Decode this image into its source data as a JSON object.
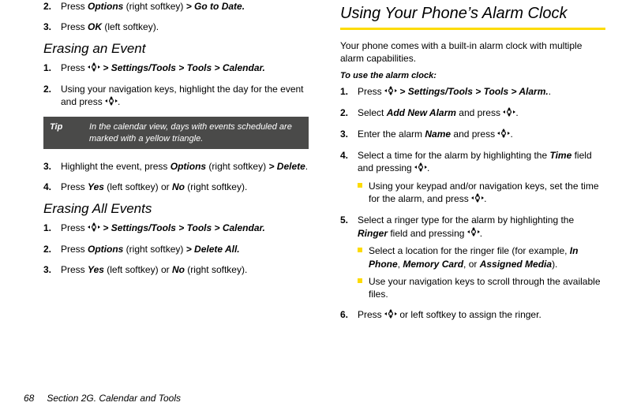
{
  "footer": {
    "page": "68",
    "section": "Section 2G. Calendar and Tools"
  },
  "left": {
    "pre_steps": [
      {
        "n": "2.",
        "parts": [
          "Press ",
          {
            "bi": "Options"
          },
          " (right softkey) ",
          {
            "bi": "> Go to Date."
          }
        ]
      },
      {
        "n": "3.",
        "parts": [
          "Press ",
          {
            "bi": "OK"
          },
          " (left softkey)."
        ]
      }
    ],
    "h2a": "Erasing an Event",
    "steps_a": [
      {
        "n": "1.",
        "parts": [
          "Press ",
          {
            "icon": true
          },
          "  ",
          {
            "bi": "> Settings/Tools > Tools > Calendar."
          }
        ]
      },
      {
        "n": "2.",
        "parts": [
          "Using your navigation keys, highlight the day for the event and press ",
          {
            "icon": true
          },
          "."
        ]
      }
    ],
    "tip": {
      "label": "Tip",
      "text": "In the calendar view, days with events scheduled are marked with a yellow triangle."
    },
    "steps_a2": [
      {
        "n": "3.",
        "parts": [
          "Highlight the event, press ",
          {
            "bi": "Options"
          },
          " (right softkey) ",
          {
            "bi": "> Delete"
          },
          "."
        ]
      },
      {
        "n": "4.",
        "parts": [
          "Press ",
          {
            "bi": "Yes"
          },
          " (left softkey) or ",
          {
            "bi": "No"
          },
          " (right softkey)."
        ]
      }
    ],
    "h2b": "Erasing All Events",
    "steps_b": [
      {
        "n": "1.",
        "parts": [
          "Press ",
          {
            "icon": true
          },
          " ",
          {
            "bi": "> Settings/Tools > Tools > Calendar."
          }
        ]
      },
      {
        "n": "2.",
        "parts": [
          "Press ",
          {
            "bi": "Options"
          },
          " (right softkey) ",
          {
            "bi": "> Delete All."
          }
        ]
      },
      {
        "n": "3.",
        "parts": [
          "Press ",
          {
            "bi": "Yes"
          },
          " (left softkey) or ",
          {
            "bi": "No"
          },
          " (right softkey)."
        ]
      }
    ]
  },
  "right": {
    "h1": "Using Your Phone’s Alarm Clock",
    "intro": "Your phone comes with a built-in alarm clock with multiple alarm capabilities.",
    "runin": "To use the alarm clock:",
    "steps": [
      {
        "n": "1.",
        "parts": [
          "Press ",
          {
            "icon": true
          },
          " ",
          {
            "bi": "> Settings/Tools > Tools > Alarm."
          },
          "."
        ]
      },
      {
        "n": "2.",
        "parts": [
          "Select ",
          {
            "bi": "Add New Alarm"
          },
          " and press ",
          {
            "icon": true
          },
          "."
        ]
      },
      {
        "n": "3.",
        "parts": [
          "Enter the alarm ",
          {
            "bi": "Name"
          },
          " and press ",
          {
            "icon": true
          },
          "."
        ]
      },
      {
        "n": "4.",
        "parts": [
          "Select a time for the alarm by highlighting the ",
          {
            "bi": "Time"
          },
          " field and pressing ",
          {
            "icon": true
          },
          "."
        ],
        "subs": [
          {
            "parts": [
              "Using your keypad and/or navigation keys, set the time for the alarm, and press ",
              {
                "icon": true
              },
              "."
            ]
          }
        ]
      },
      {
        "n": "5.",
        "parts": [
          "Select a ringer type for the alarm by highlighting the ",
          {
            "bi": "Ringer"
          },
          " field and pressing ",
          {
            "icon": true
          },
          "."
        ],
        "subs": [
          {
            "parts": [
              "Select a location for the ringer file (for example, ",
              {
                "bi": "In Phone"
              },
              ", ",
              {
                "bi": "Memory Card"
              },
              ", or ",
              {
                "bi": "Assigned Media"
              },
              ")."
            ]
          },
          {
            "parts": [
              "Use your navigation keys to scroll through the available files."
            ]
          }
        ]
      },
      {
        "n": "6.",
        "parts": [
          "Press ",
          {
            "icon": true
          },
          " or left softkey to assign the ringer."
        ]
      }
    ]
  }
}
